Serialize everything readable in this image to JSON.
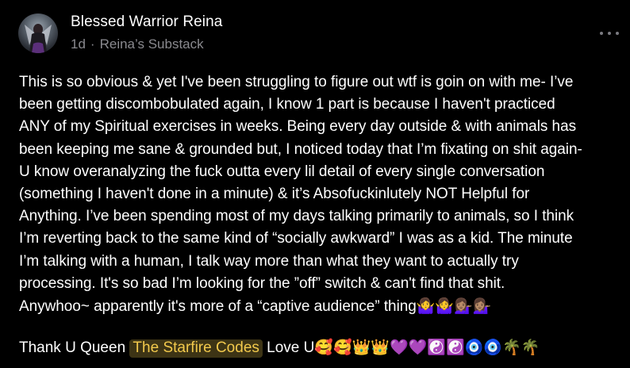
{
  "post": {
    "author": "Blessed Warrior Reina",
    "age": "1d",
    "separator": "·",
    "publication": "Reina’s Substack",
    "body_lines": [
      "This is so obvious & yet I've been struggling to figure out wtf is goin on with me- I’ve",
      "been getting discombobulated again, I know 1 part is because I haven't practiced",
      "ANY of my Spiritual exercises in weeks. Being every day outside & with animals has",
      "been keeping me sane & grounded but, I noticed today that I’m fixating on shit again-",
      "U know overanalyzing the fuck outta every lil detail of every single conversation",
      "(something I haven't done in a minute) & it’s Absofuckinlutely NOT Helpful for",
      "Anything. I’ve been spending most of my days talking primarily to animals, so I think",
      "I’m reverting back to the same kind of “socially awkward” I was as a kid. The minute",
      "I’m talking with a human, I talk way more than what they want to actually try",
      "processing. It's so bad I’m looking for the ”off” switch & can't find that shit.",
      "Anywhoo~ apparently it's more of a “captive audience” thing"
    ],
    "last_line_emojis": "🤷‍♀️🤷‍♀️💁🏽‍♀️💁🏽‍♀️",
    "footer_prefix": "Thank U Queen ",
    "mention": "The Starfire Codes",
    "footer_suffix": " Love U",
    "footer_emojis": "🥰🥰👑👑💜💜☯️☯️🧿🧿🌴🌴"
  },
  "icons": {
    "avatar": "avatar-image",
    "more": "more-options-icon"
  },
  "colors": {
    "background": "#000000",
    "text": "#ffffff",
    "muted": "#8a8a8f",
    "mention_text": "#f2c94c",
    "mention_bg": "#3d3415"
  }
}
